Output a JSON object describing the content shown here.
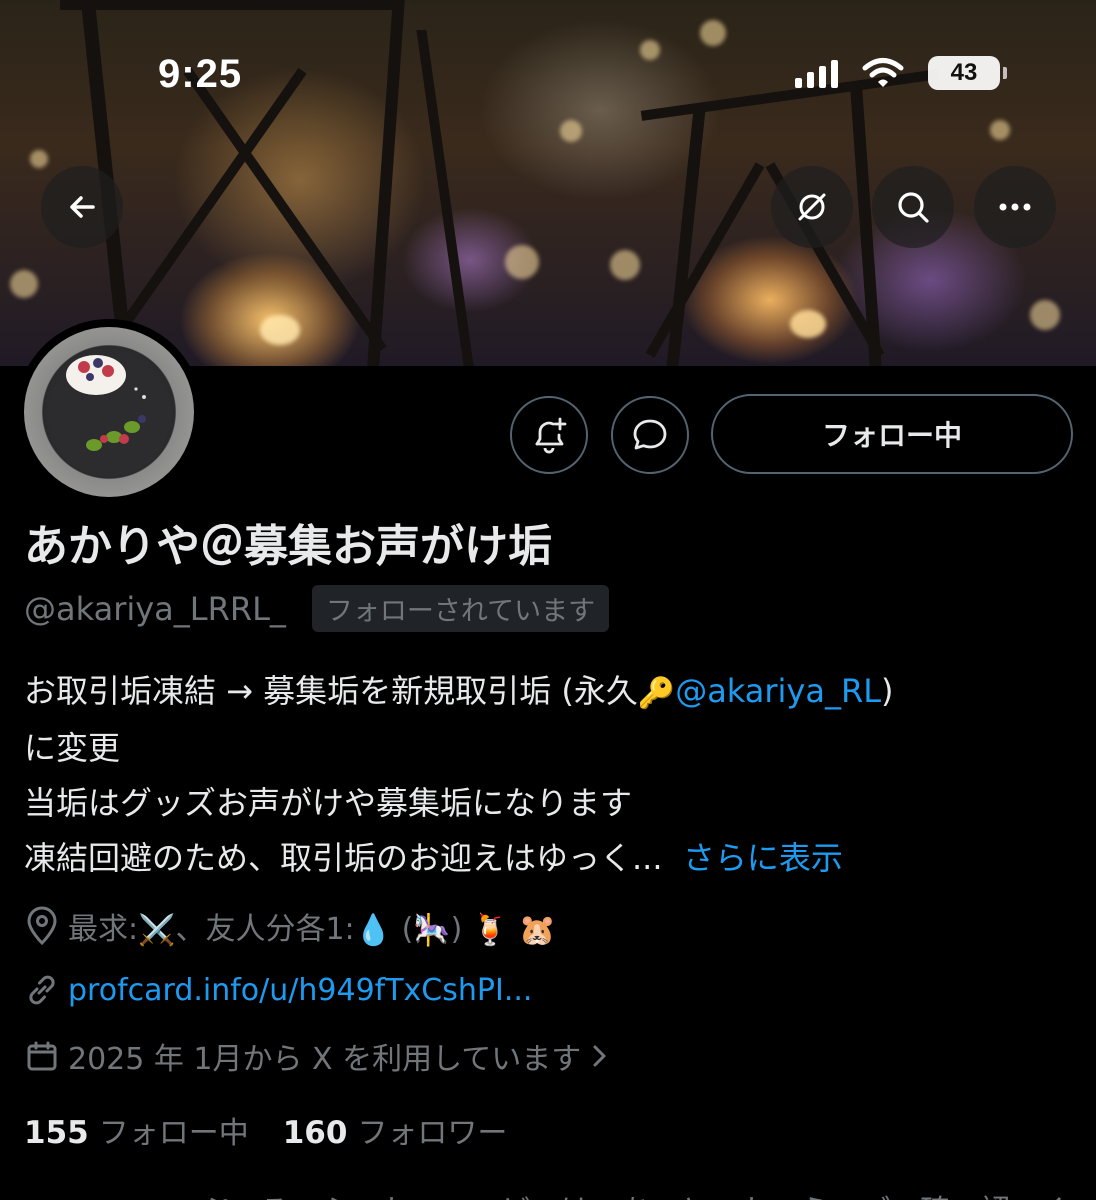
{
  "status_bar": {
    "time": "9:25",
    "battery": "43"
  },
  "nav": {
    "back_icon": "arrow-left-icon",
    "grok_icon": "grok-slash-icon",
    "search_icon": "search-icon",
    "more_icon": "more-horizontal-icon"
  },
  "actions": {
    "notify_icon": "bell-plus-icon",
    "message_icon": "chat-bubble-icon",
    "follow_label": "フォロー中"
  },
  "profile": {
    "display_name": "あかりや＠募集お声がけ垢",
    "handle": "@akariya_LRRL_",
    "follows_you": "フォローされています",
    "bio": {
      "line1_prefix": "お取引垢凍結 → 募集垢を新規取引垢 (永久",
      "line1_emoji": "🔑",
      "line1_mention": "@akariya_RL",
      "line1_suffix": ")",
      "line2": "に変更",
      "line3": "当垢はグッズお声がけや募集垢になります",
      "line4": "凍結回避のため、取引垢のお迎えはゆっく...",
      "show_more": "さらに表示"
    },
    "location": {
      "prefix": "最求:",
      "emoji1": "⚔️",
      "mid": "、友人分各1:",
      "emoji2": "💧",
      "paren_open": "(",
      "emoji3": "🎠",
      "paren_close": ")",
      "emoji4": "🍹",
      "emoji5": "🐹"
    },
    "website": "profcard.info/u/h949fTxCshPI...",
    "joined": "2025 年 1月から X を利用しています"
  },
  "stats": {
    "following_count": "155",
    "following_label": "フォロー中",
    "followers_count": "160",
    "followers_label": "フォロワー"
  },
  "truncated_next_line": "ぷ　ろ　ふ　か　ー　ど　は　あ　と　か　ら　ご　確　認　く　だ　さ　い"
}
